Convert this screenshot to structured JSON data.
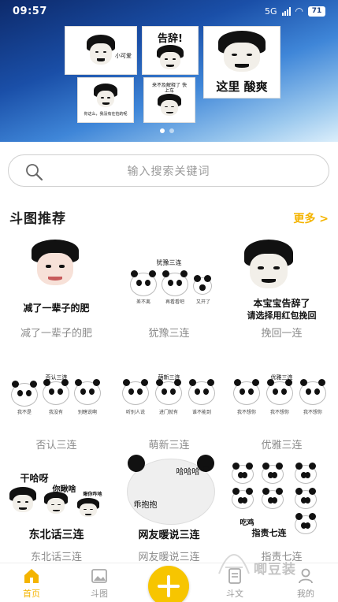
{
  "status_bar": {
    "time": "09:57",
    "network": "5G",
    "battery": "71"
  },
  "banner": {
    "memes": [
      {
        "caption": "小可爱"
      },
      {
        "caption": "告辞!"
      },
      {
        "caption": "这里 酸爽"
      },
      {
        "caption": "你这么，我没有在怕的呢"
      },
      {
        "caption": "来不及解释了 快上车"
      }
    ],
    "page_count": 2,
    "active_page": 1
  },
  "search": {
    "placeholder": "输入搜索关键词"
  },
  "section": {
    "title": "斗图推荐",
    "more_label": "更多 >"
  },
  "grid": [
    {
      "caption": "减了一辈子的肥",
      "overlay": "减了一辈子的肥"
    },
    {
      "caption": "犹豫三连",
      "overlay": "犹豫三连",
      "sub_labels": [
        "差不离",
        "再看看吧",
        "又开了"
      ]
    },
    {
      "caption": "挽回一连",
      "overlay_lines": [
        "本宝宝告辞了",
        "请选择用红包挽回"
      ]
    },
    {
      "caption": "否认三连",
      "overlay": "否认三连",
      "sub_labels": [
        "我不是",
        "我没有",
        "别瞎说啊"
      ]
    },
    {
      "caption": "萌新三连",
      "overlay": "萌新三连",
      "sub_labels": [
        "听别人说",
        "进门就有",
        "谁不能到"
      ]
    },
    {
      "caption": "优雅三连",
      "overlay": "优雅三连",
      "sub_labels": [
        "我不想你",
        "我不想你",
        "我不想你"
      ]
    },
    {
      "caption": "东北话三连",
      "overlay_lines": [
        "干哈呀",
        "你瞅啥",
        "瞅你咋地",
        "东北话三连"
      ]
    },
    {
      "caption": "网友暖说三连",
      "overlay_lines": [
        "哈哈哈",
        "乖抱抱",
        "网友暖说三连"
      ]
    },
    {
      "caption": "指责七连",
      "overlay_lines": [
        "吃鸡",
        "指责七连"
      ]
    }
  ],
  "nav": {
    "items": [
      {
        "label": "首页",
        "icon": "home-icon",
        "active": true
      },
      {
        "label": "斗图",
        "icon": "image-icon",
        "active": false
      },
      {
        "label": "斗文",
        "icon": "document-icon",
        "active": false
      },
      {
        "label": "我的",
        "icon": "person-icon",
        "active": false
      }
    ],
    "fab_icon": "plus-icon"
  },
  "watermark": "唧豆装"
}
